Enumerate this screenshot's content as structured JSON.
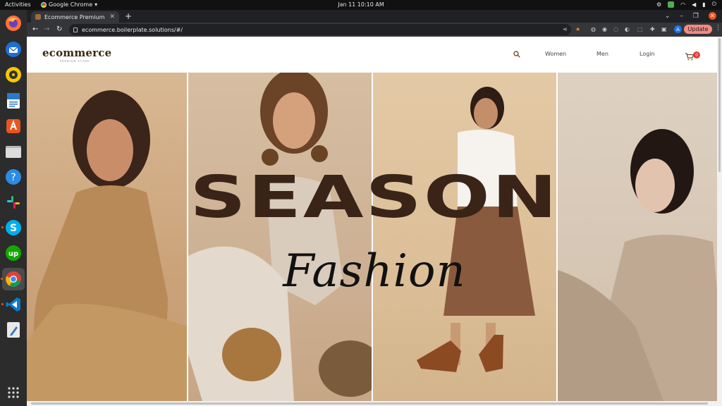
{
  "system": {
    "activities_label": "Activities",
    "app_name": "Google Chrome",
    "clock": "Jan 11  10:10 AM"
  },
  "dock": {
    "items": [
      {
        "name": "firefox-icon"
      },
      {
        "name": "thunderbird-icon"
      },
      {
        "name": "rhythmbox-icon"
      },
      {
        "name": "libreoffice-writer-icon"
      },
      {
        "name": "software-center-icon"
      },
      {
        "name": "files-icon"
      },
      {
        "name": "help-icon"
      },
      {
        "name": "slack-icon"
      },
      {
        "name": "skype-icon"
      },
      {
        "name": "upwork-icon"
      },
      {
        "name": "chrome-icon"
      },
      {
        "name": "vscode-icon"
      },
      {
        "name": "text-editor-icon"
      },
      {
        "name": "app-grid-icon"
      }
    ]
  },
  "browser": {
    "tab_title": "Ecommerce Premium",
    "url": "ecommerce.boilerplate.solutions/#/",
    "profile_initial": "A",
    "update_label": "Update"
  },
  "site": {
    "logo": "ecommerce",
    "logo_tagline": "PREMIUM STORE",
    "nav": {
      "women": "Women",
      "men": "Men",
      "login": "Login"
    },
    "cart_count": "0"
  },
  "hero": {
    "headline": "SEASON",
    "script": "Fashion"
  },
  "colors": {
    "accent": "#e95420",
    "headline": "#3a2418",
    "badge": "#e53935"
  }
}
